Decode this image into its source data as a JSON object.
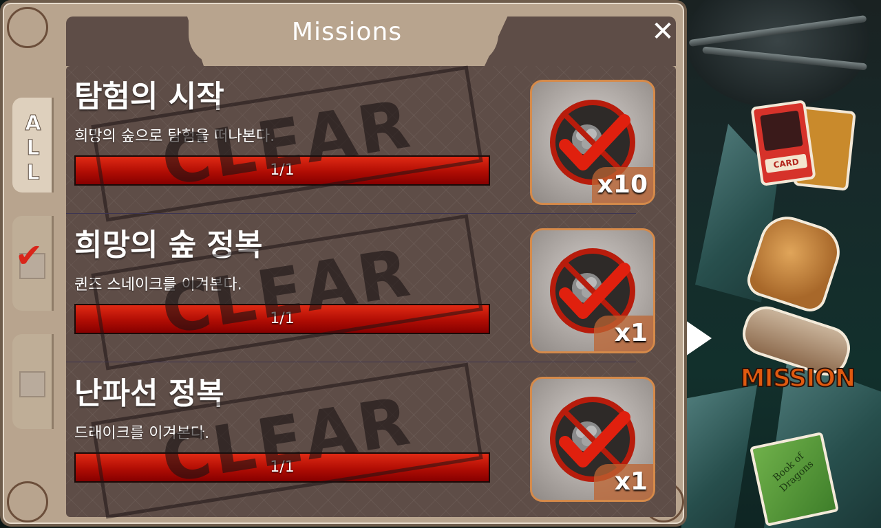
{
  "panel": {
    "title": "Missions",
    "close_label": "✕"
  },
  "tabs": [
    {
      "label": "A\nL\nL",
      "state": "all"
    },
    {
      "state": "completed"
    },
    {
      "state": "incomplete"
    }
  ],
  "missions": [
    {
      "title": "탐험의 시작",
      "description": "희망의 숲으로 탐험을 떠나본다.",
      "progress_text": "1/1",
      "progress": 1.0,
      "stamp": "CLEAR",
      "reward_qty": "x10"
    },
    {
      "title": "희망의 숲 정복",
      "description": "퀸즈 스네이크를 이겨본다.",
      "progress_text": "1/1",
      "progress": 1.0,
      "stamp": "CLEAR",
      "reward_qty": "x1"
    },
    {
      "title": "난파선 정복",
      "description": "드래이크를 이겨본다.",
      "progress_text": "1/1",
      "progress": 1.0,
      "stamp": "CLEAR",
      "reward_qty": "x1"
    }
  ],
  "side_menu": {
    "card_label": "CARD",
    "mission_label": "MISSION",
    "book_label": "Book of Dragons"
  },
  "colors": {
    "progress_red": "#c8140a",
    "panel_frame": "#b8a48e",
    "check_red": "#e01f10"
  }
}
